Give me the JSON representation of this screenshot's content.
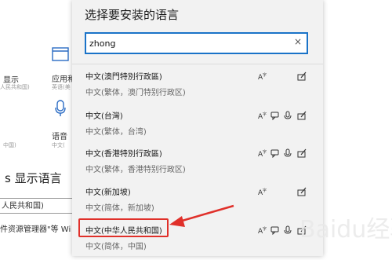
{
  "background": {
    "display_label": "显示",
    "display_sub": "人民共和国)",
    "apps_label": "应用和",
    "apps_sub": "英语(美",
    "voice_label": "语音",
    "voice_sub": "中文(",
    "region_sub": "中国)",
    "heading_prefix": "s",
    "heading": "显示语言",
    "select_value": "人民共和国)",
    "cut_text": "件资源管理器\"等 Wi"
  },
  "dialog": {
    "title": "选择要安装的语言",
    "search": {
      "value": "zhong",
      "clear_icon": "×"
    },
    "languages": [
      {
        "name": "中文(澳門特別行政區)",
        "sub": "中文(繁体，澳门特别行政区)",
        "features": [
          "display-language-icon",
          "",
          "",
          "handwriting-icon"
        ]
      },
      {
        "name": "中文(台灣)",
        "sub": "中文(繁体，台湾)",
        "features": [
          "display-language-icon",
          "speech-icon",
          "microphone-icon",
          "handwriting-icon"
        ]
      },
      {
        "name": "中文(香港特別行政區)",
        "sub": "中文(繁体，香港特别行政区)",
        "features": [
          "display-language-icon",
          "speech-icon",
          "microphone-icon",
          "handwriting-icon"
        ]
      },
      {
        "name": "中文(新加坡)",
        "sub": "中文(简体，新加坡)",
        "features": [
          "display-language-icon",
          "",
          "",
          "handwriting-icon"
        ]
      },
      {
        "name": "中文(中华人民共和国)",
        "sub": "中文(简体，中国)",
        "features": [
          "display-language-icon",
          "speech-icon",
          "microphone-icon",
          "handwriting-icon"
        ]
      }
    ]
  },
  "annotation": {
    "highlight_color": "#e0302a"
  },
  "watermark": {
    "text": "Baidu经验"
  },
  "colors": {
    "accent": "#1a73c8",
    "dialog_bg": "#f2f2f2"
  }
}
